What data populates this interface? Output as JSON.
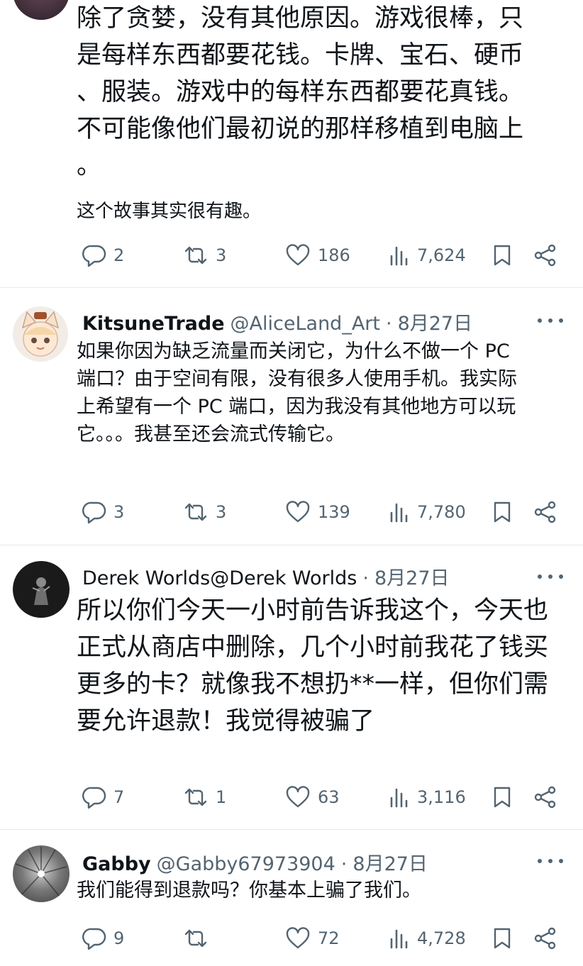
{
  "posts": [
    {
      "text_lines": [
        "除了贪婪，没有其他原因。游戏很棒，只",
        "是每样东西都要花钱。卡牌、宝石、硬币",
        "、服装。游戏中的每样东西都要花真钱。",
        "不可能像他们最初说的那样移植到电脑上",
        "。"
      ],
      "text2": "这个故事其实很有趣。",
      "replies": "2",
      "reposts": "3",
      "likes": "186",
      "views": "7,624"
    },
    {
      "name": "KitsuneTrade",
      "handle": "@AliceLand_Art",
      "dot": "·",
      "date": "8月27日",
      "text_lines": [
        "如果你因为缺乏流量而关闭它，为什么不做一个 PC",
        "端口？由于空间有限，没有很多人使用手机。我实际",
        "上希望有一个 PC 端口，因为我没有其他地方可以玩",
        "它。。。我甚至还会流式传输它。"
      ],
      "replies": "3",
      "reposts": "3",
      "likes": "139",
      "views": "7,780"
    },
    {
      "name": "Derek Worlds",
      "handle": "@Derek Worlds",
      "dot": "·",
      "date": "8月27日",
      "text_lines": [
        "所以你们今天一小时前告诉我这个，今天也",
        "正式从商店中删除，几个小时前我花了钱买",
        "更多的卡？就像我不想扔**一样，但你们需",
        "要允许退款！我觉得被骗了"
      ],
      "replies": "7",
      "reposts": "1",
      "likes": "63",
      "views": "3,116"
    },
    {
      "name": "Gabby",
      "handle": "@Gabby67973904",
      "dot": "·",
      "date": "8月27日",
      "text_lines": [
        "我们能得到退款吗？你基本上骗了我们。"
      ],
      "replies": "9",
      "reposts": "",
      "likes": "72",
      "views": "4,728"
    }
  ],
  "icons": {
    "reply": "reply-icon",
    "repost": "repost-icon",
    "like": "like-icon",
    "views": "views-icon",
    "bookmark": "bookmark-icon",
    "share": "share-icon",
    "more": "more-icon"
  },
  "colors": {
    "text": "#0f1419",
    "muted": "#536471",
    "divider": "#e6e9ec"
  }
}
